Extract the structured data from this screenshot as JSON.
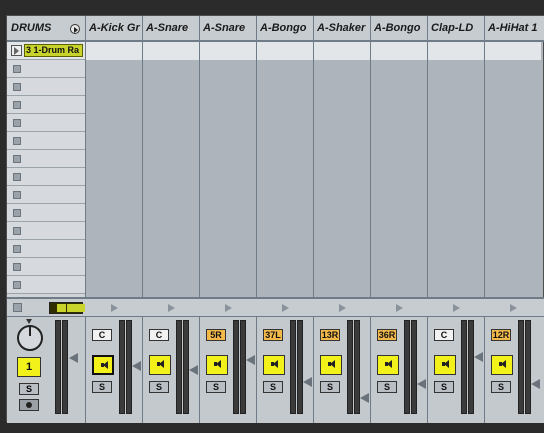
{
  "group": {
    "title": "DRUMS",
    "clip_name": "3 1-Drum Ra",
    "track_number": "1",
    "solo_label": "S"
  },
  "tracks": [
    {
      "name": "A-Kick Gr",
      "pan": "C",
      "pan_active": false
    },
    {
      "name": "A-Snare",
      "pan": "C",
      "pan_active": false
    },
    {
      "name": "A-Snare",
      "pan": "5R",
      "pan_active": true
    },
    {
      "name": "A-Bongo",
      "pan": "37L",
      "pan_active": true
    },
    {
      "name": "A-Shaker",
      "pan": "13R",
      "pan_active": true
    },
    {
      "name": "A-Bongo",
      "pan": "36R",
      "pan_active": true
    },
    {
      "name": "Clap-LD",
      "pan": "C",
      "pan_active": false
    },
    {
      "name": "A-HiHat 1",
      "pan": "12R",
      "pan_active": true
    }
  ],
  "solo_label": "S",
  "colors": {
    "clip": "#c8d42c",
    "activator": "#f2f21a",
    "pan_offset": "#f2b84a"
  }
}
